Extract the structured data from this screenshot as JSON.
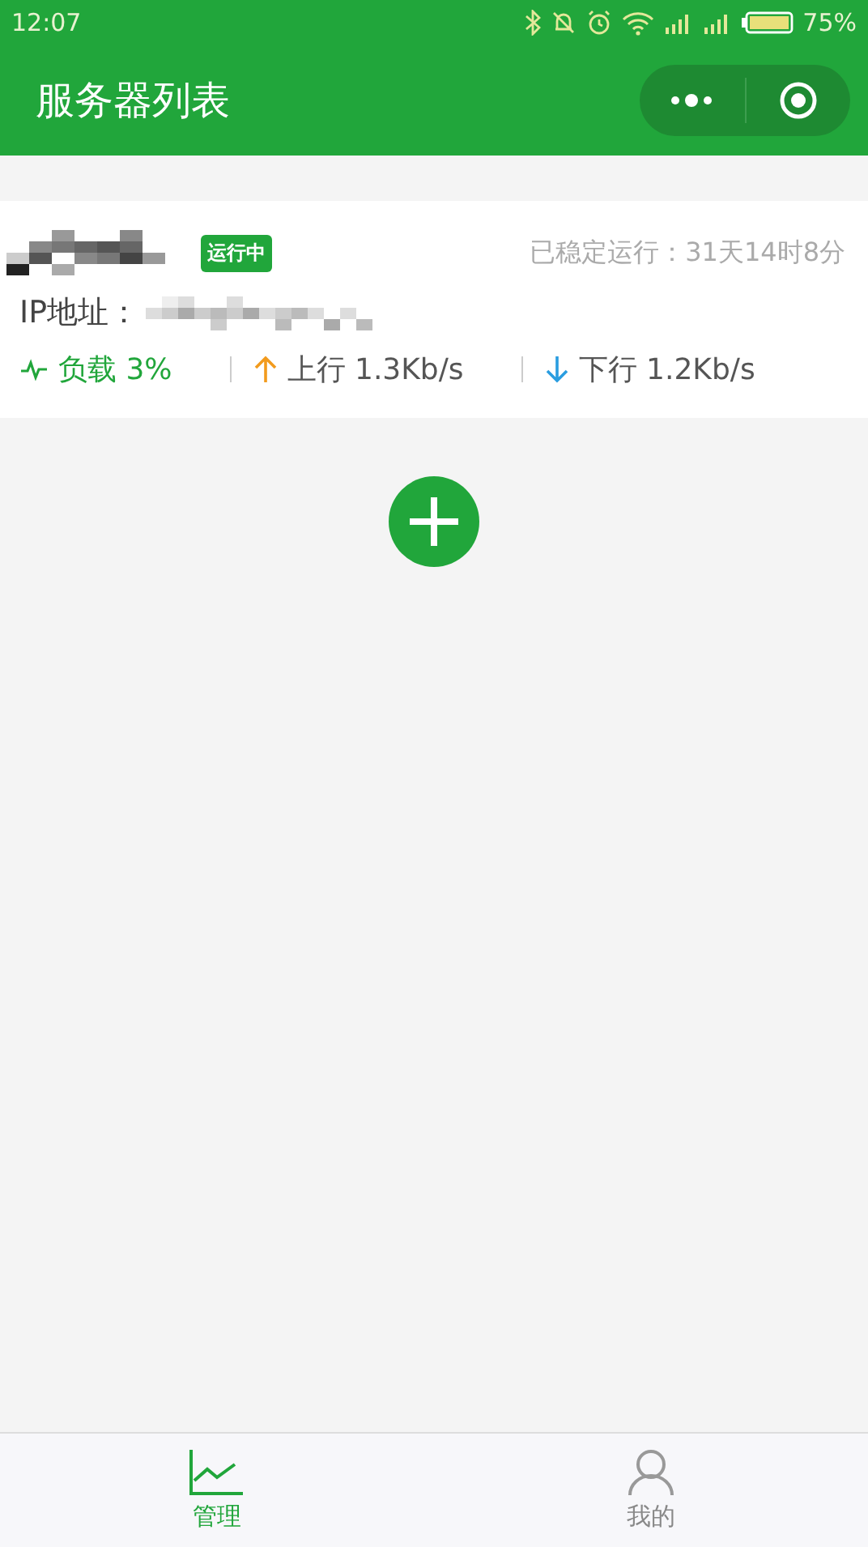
{
  "status_bar": {
    "time": "12:07",
    "battery": "75%"
  },
  "header": {
    "title": "服务器列表"
  },
  "servers": [
    {
      "status": {
        "label": "运行中",
        "kind": "running"
      },
      "uptime": "已稳定运行：31天14时8分",
      "ip_label": "IP地址：",
      "load": "负载 3%",
      "upload": "上行 1.3Kb/s",
      "download": "下行 1.2Kb/s"
    }
  ],
  "tabs": [
    {
      "label": "管理",
      "selected": true,
      "kind": "chart"
    },
    {
      "label": "我的",
      "selected": false,
      "kind": "person"
    }
  ]
}
